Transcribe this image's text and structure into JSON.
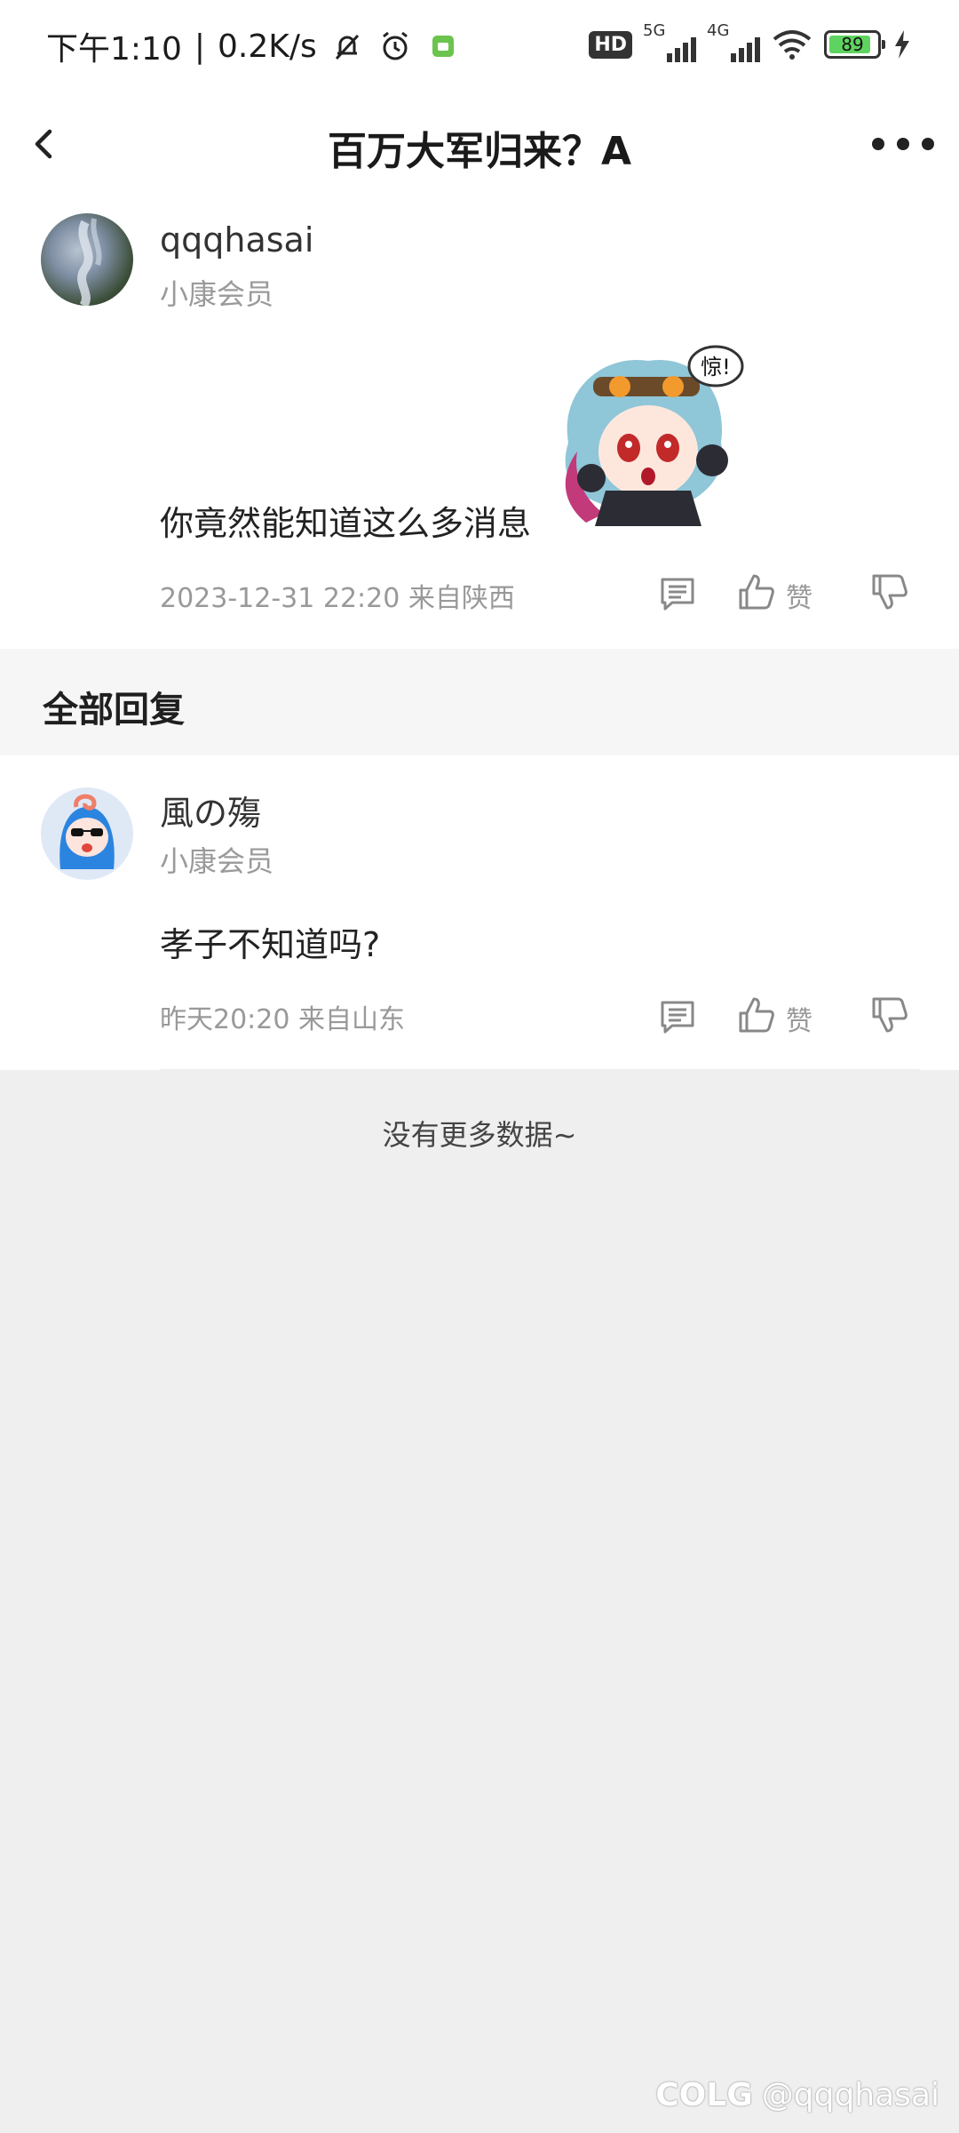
{
  "status_bar": {
    "time": "下午1:10",
    "speed": "0.2K/s",
    "hd": "HD",
    "net1": "5G",
    "net2": "4G",
    "battery": "89",
    "battery_level": 0.89
  },
  "header": {
    "title": "百万大军归来？A"
  },
  "post": {
    "username": "qqqhasai",
    "level": "小康会员",
    "content": "你竟然能知道这么多消息",
    "sticker_text": "惊!",
    "meta": "2023-12-31 22:20  来自陕西",
    "like_label": "赞"
  },
  "replies": {
    "title": "全部回复",
    "items": [
      {
        "username": "風の殤",
        "level": "小康会员",
        "content": "孝子不知道吗?",
        "meta": "昨天20:20 来自山东",
        "like_label": "赞"
      }
    ]
  },
  "footer": {
    "no_more": "没有更多数据~"
  },
  "watermark": {
    "logo": "COLG",
    "handle": "@qqqhasai"
  },
  "icons": {
    "back": "chevron-left-icon",
    "more": "more-dots-icon",
    "comment": "comment-icon",
    "like": "thumb-up-icon",
    "dislike": "thumb-down-icon"
  }
}
